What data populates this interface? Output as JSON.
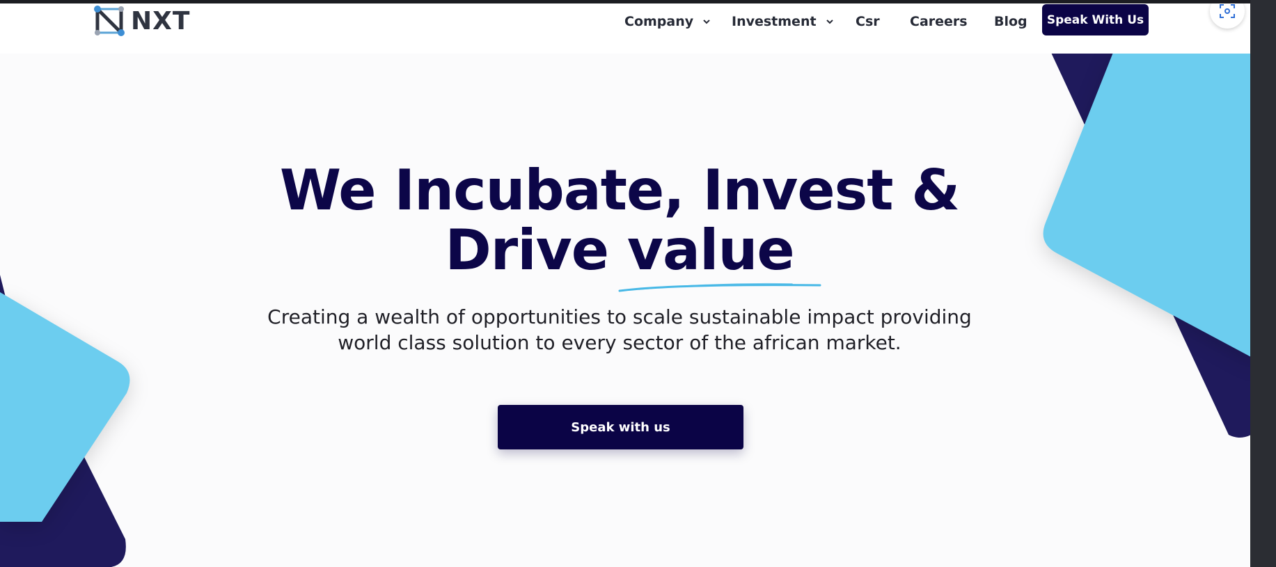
{
  "brand": {
    "name": "NXT"
  },
  "nav": {
    "items": [
      {
        "label": "Company",
        "has_dropdown": true
      },
      {
        "label": "Investment",
        "has_dropdown": true
      },
      {
        "label": "Csr",
        "has_dropdown": false
      },
      {
        "label": "Careers",
        "has_dropdown": false
      },
      {
        "label": "Blog",
        "has_dropdown": false
      }
    ],
    "cta_label": "Speak With Us"
  },
  "hero": {
    "title_line1": "We Incubate, Invest &",
    "title_line2": "Drive value",
    "subtitle_line1": "Creating a wealth of opportunities to scale sustainable impact providing",
    "subtitle_line2": "world class solution to every sector of the african market.",
    "cta_label": "Speak with us"
  },
  "floating_button": {
    "icon": "scan-icon"
  },
  "colors": {
    "navy": "#0b0446",
    "light_blue": "#6ccdef",
    "dark_purple": "#1f1a5c",
    "text": "#262a36"
  }
}
